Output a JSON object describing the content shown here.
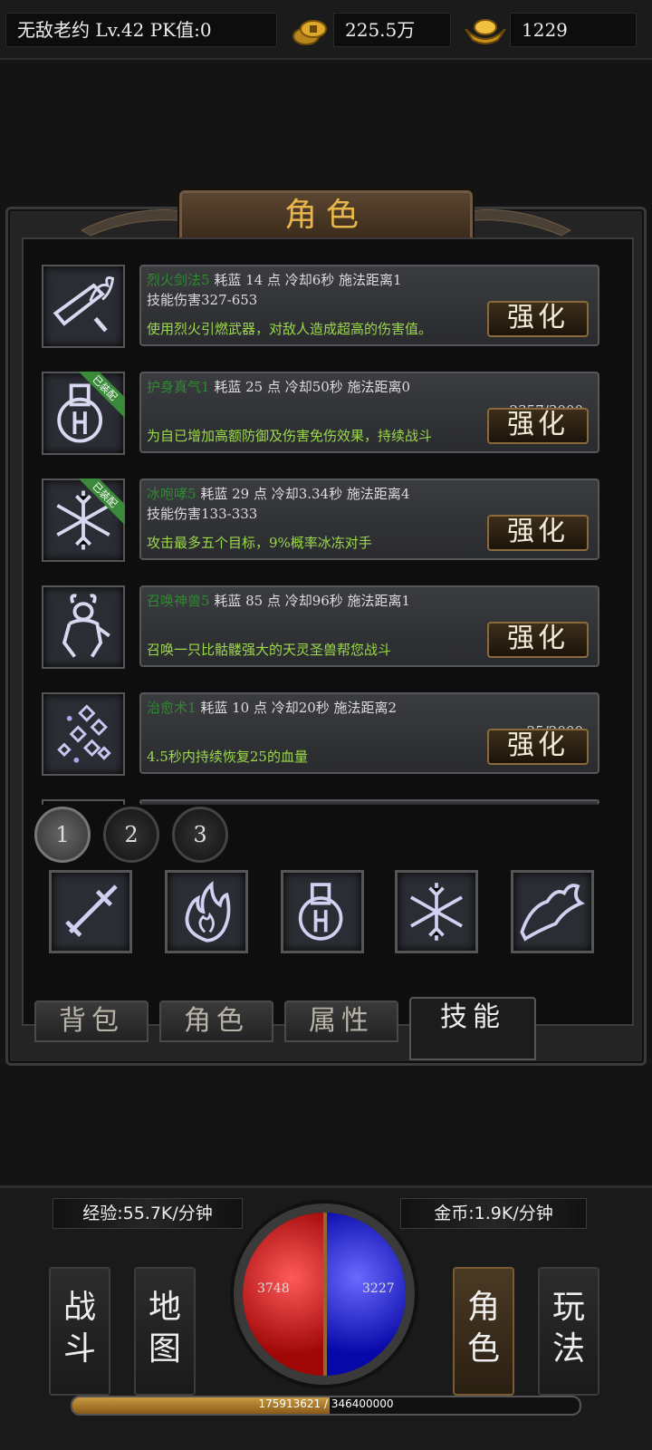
{
  "topbar": {
    "player": "无敌老约  Lv.42 PK值:0",
    "gold": "225.5万",
    "ingots": "1229"
  },
  "panel": {
    "title": "角色"
  },
  "skills": [
    {
      "name": "烈火剑法5",
      "stats": " 耗蓝 14 点  冷却6秒   施法距离1",
      "damage": "技能伤害327-653",
      "desc": "使用烈火引燃武器，对敌人造成超高的伤害值。",
      "progress": "",
      "button": "强化",
      "equipped": "",
      "icon": "sword-fire-icon"
    },
    {
      "name": "护身真气1",
      "stats": " 耗蓝 25 点  冷却50秒  施法距离0",
      "damage": "",
      "desc": "为自已增加高额防御及伤害免伤效果，持续战斗",
      "progress": "2357/3000",
      "button": "强化",
      "equipped": "已装配",
      "icon": "shield-body-icon"
    },
    {
      "name": "冰咆哮5",
      "stats": " 耗蓝 29 点  冷却3.34秒   施法距离4",
      "damage": "技能伤害133-333",
      "desc": "攻击最多五个目标，9%概率冰冻对手",
      "progress": "",
      "button": "强化",
      "equipped": "已装配",
      "icon": "snowflake-icon"
    },
    {
      "name": "召唤神兽5",
      "stats": " 耗蓝 85 点  冷却96秒  施法距离1",
      "damage": "",
      "desc": "召唤一只比骷髅强大的天灵圣兽帮您战斗",
      "progress": "",
      "button": "强化",
      "equipped": "",
      "icon": "beast-icon"
    },
    {
      "name": "治愈术1",
      "stats": " 耗蓝 10 点  冷却20秒  施法距离2",
      "damage": "",
      "desc": "4.5秒内持续恢复25的血量",
      "progress": "25/2000",
      "button": "强化",
      "equipped": "",
      "icon": "heal-sparkle-icon"
    }
  ],
  "pages": [
    "1",
    "2",
    "3"
  ],
  "tabs": [
    "背包",
    "角色",
    "属性",
    "技能"
  ],
  "hud": {
    "exp_rate": "经验:55.7K/分钟",
    "gold_rate": "金币:1.9K/分钟",
    "hp": "3748",
    "mp": "3227",
    "exp_text": "175913621 / 346400000",
    "exp_fraction": 0.508,
    "nav": {
      "battle": "战斗",
      "map": "地图",
      "role": "角色",
      "play": "玩法"
    }
  },
  "colors": {
    "accent": "#e8b64a",
    "skill_name": "#2e8a2e",
    "skill_desc": "#9bd84a",
    "hp": "#d02020",
    "mp": "#2020d0"
  }
}
